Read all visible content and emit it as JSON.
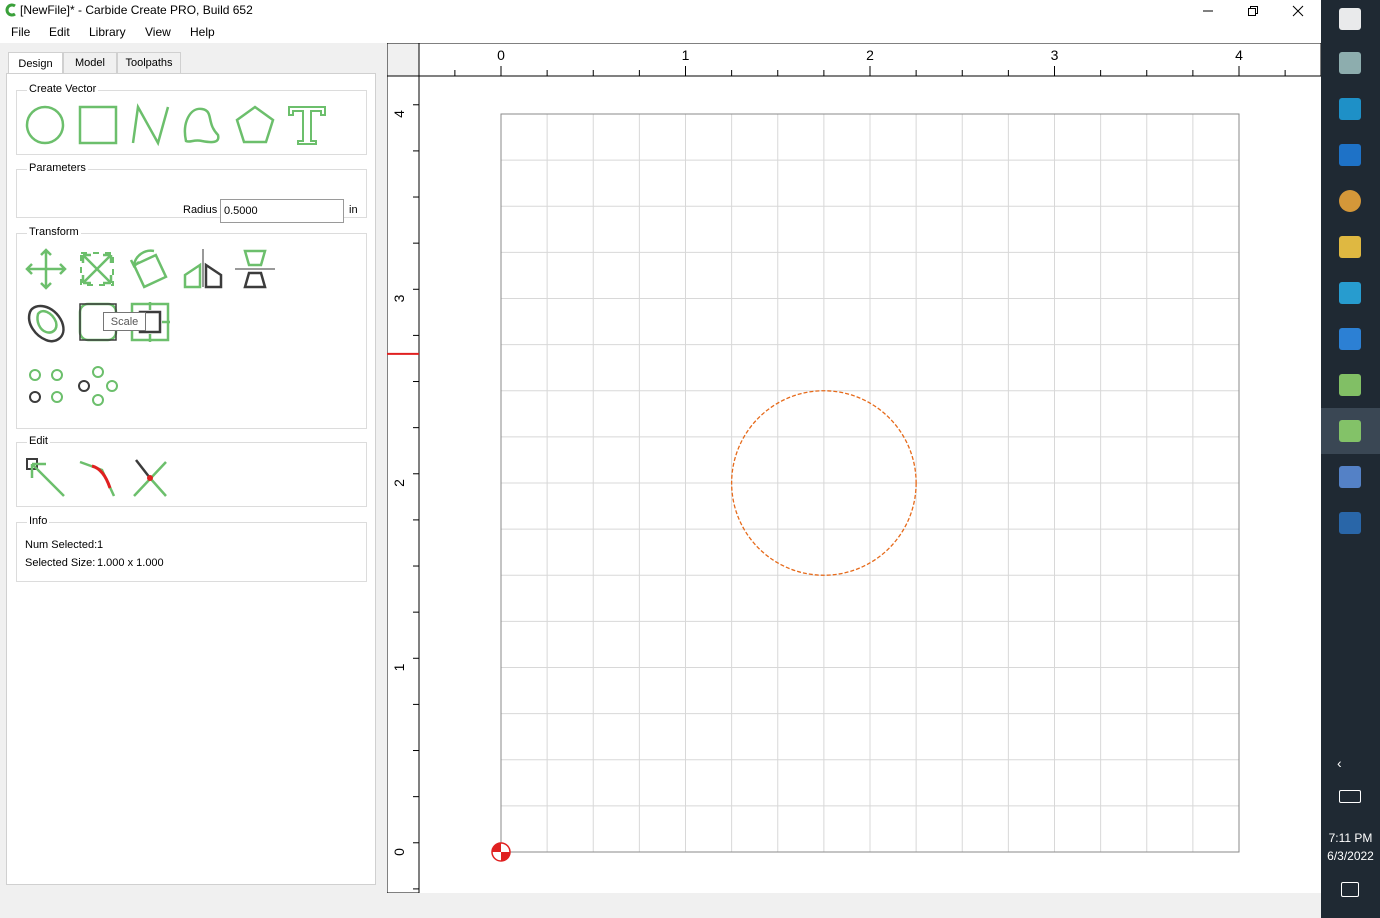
{
  "window": {
    "title": "[NewFile]* - Carbide Create PRO, Build 652"
  },
  "menu": [
    "File",
    "Edit",
    "Library",
    "View",
    "Help"
  ],
  "tabs": [
    "Design",
    "Model",
    "Toolpaths"
  ],
  "groups": {
    "create_vector": "Create Vector",
    "parameters": "Parameters",
    "transform": "Transform",
    "edit": "Edit",
    "info": "Info"
  },
  "parameters": {
    "radius_label": "Radius",
    "radius_value": "0.5000",
    "unit": "in"
  },
  "tooltip": "Scale",
  "info": {
    "num_selected_label": "Num Selected:",
    "num_selected": "1",
    "selected_size_label": "Selected Size:",
    "selected_size": "1.000 x 1.000"
  },
  "ruler": {
    "x_labels": [
      "0",
      "1",
      "2",
      "3",
      "4"
    ],
    "y_labels": [
      "0",
      "1",
      "2",
      "3",
      "4"
    ],
    "cursor_y": 2.7
  },
  "stock": {
    "width": 4,
    "height": 4,
    "grid": 0.25
  },
  "circle": {
    "center_x": 1.75,
    "center_y": 2.0,
    "radius": 0.5,
    "color": "#e66a1a"
  },
  "colors": {
    "tool_green": "#6cbf6c",
    "tool_dark": "#3c3c3c",
    "accent_red": "#e02020"
  },
  "taskbar": {
    "icons": [
      "windows-icon",
      "network-app-icon",
      "onenote-icon",
      "edge-icon",
      "chrome-icon",
      "file-explorer-icon",
      "app-icon",
      "affinity-designer-icon",
      "carbide-create-icon",
      "carbide-create-active-icon",
      "globe-app-icon",
      "bc-app-icon"
    ],
    "time": "7:11 PM",
    "date": "6/3/2022"
  }
}
